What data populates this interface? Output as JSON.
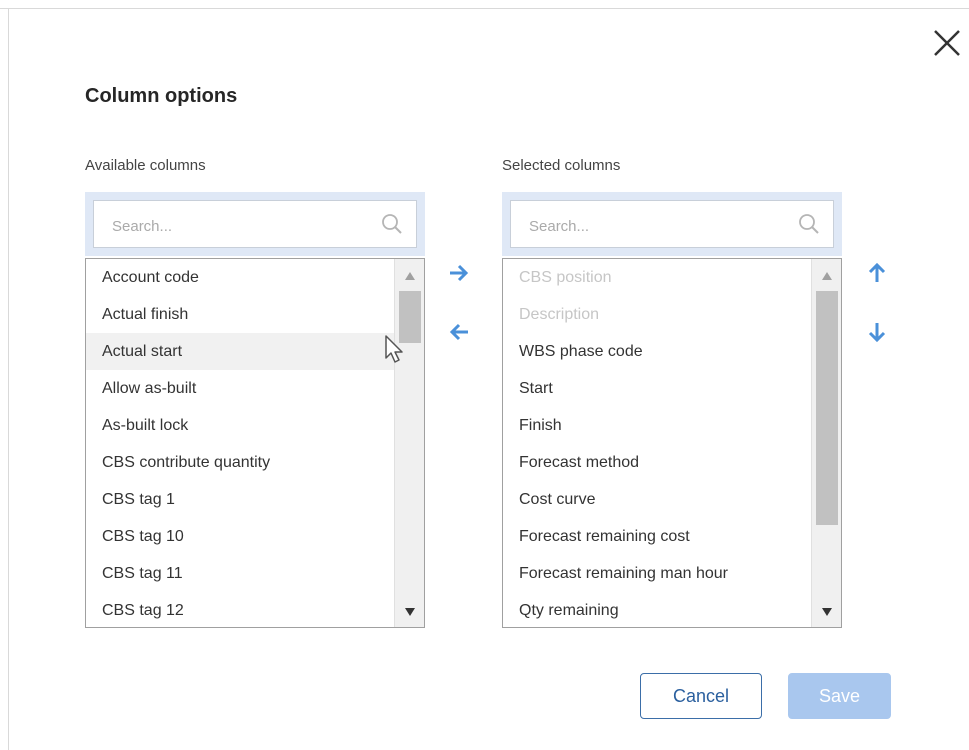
{
  "dialog": {
    "title": "Column options",
    "close_icon": "close-icon"
  },
  "available": {
    "label": "Available columns",
    "search_placeholder": "Search...",
    "items": [
      {
        "label": "Account code",
        "disabled": false
      },
      {
        "label": "Actual finish",
        "disabled": false
      },
      {
        "label": "Actual start",
        "disabled": false,
        "hovered": true
      },
      {
        "label": "Allow as-built",
        "disabled": false
      },
      {
        "label": "As-built lock",
        "disabled": false
      },
      {
        "label": "CBS contribute quantity",
        "disabled": false
      },
      {
        "label": "CBS tag 1",
        "disabled": false
      },
      {
        "label": "CBS tag 10",
        "disabled": false
      },
      {
        "label": "CBS tag 11",
        "disabled": false
      },
      {
        "label": "CBS tag 12",
        "disabled": false
      }
    ]
  },
  "selected": {
    "label": "Selected columns",
    "search_placeholder": "Search...",
    "items": [
      {
        "label": "CBS position",
        "disabled": true
      },
      {
        "label": "Description",
        "disabled": true
      },
      {
        "label": "WBS phase code",
        "disabled": false
      },
      {
        "label": "Start",
        "disabled": false
      },
      {
        "label": "Finish",
        "disabled": false
      },
      {
        "label": "Forecast method",
        "disabled": false
      },
      {
        "label": "Cost curve",
        "disabled": false
      },
      {
        "label": "Forecast remaining cost",
        "disabled": false
      },
      {
        "label": "Forecast remaining man hour",
        "disabled": false
      },
      {
        "label": "Qty remaining",
        "disabled": false
      }
    ]
  },
  "transfer": {
    "add_icon": "arrow-right-icon",
    "remove_icon": "arrow-left-icon"
  },
  "reorder": {
    "up_icon": "arrow-up-icon",
    "down_icon": "arrow-down-icon"
  },
  "footer": {
    "cancel_label": "Cancel",
    "save_label": "Save"
  },
  "colors": {
    "accent": "#4a90d9",
    "primary_disabled": "#a9c7ee",
    "search_band": "#dfe8f6"
  }
}
